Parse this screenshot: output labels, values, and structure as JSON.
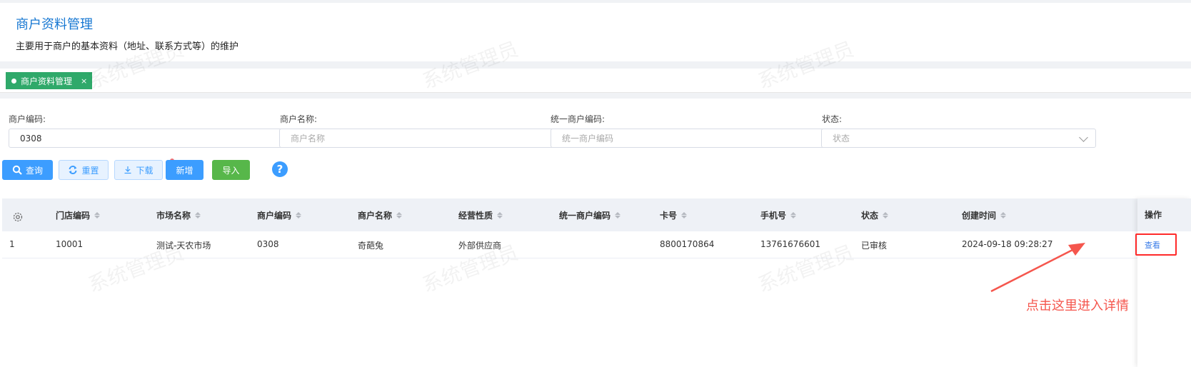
{
  "header": {
    "title": "商户资料管理",
    "description": "主要用于商户的基本资料（地址、联系方式等）的维护"
  },
  "tabs": [
    {
      "label": "商户资料管理",
      "close": "×"
    }
  ],
  "filters": {
    "merchant_code": {
      "label": "商户编码:",
      "value": "0308"
    },
    "merchant_name": {
      "label": "商户名称:",
      "placeholder": "商户名称"
    },
    "unified_code": {
      "label": "统一商户编码:",
      "placeholder": "统一商户编码"
    },
    "status": {
      "label": "状态:",
      "placeholder": "状态"
    }
  },
  "buttons": {
    "query": "查询",
    "reset": "重置",
    "download": "下载",
    "add": "新增",
    "import": "导入",
    "help": "?"
  },
  "table": {
    "columns": [
      "门店编码",
      "市场名称",
      "商户编码",
      "商户名称",
      "经营性质",
      "统一商户编码",
      "卡号",
      "手机号",
      "状态",
      "创建时间",
      "操作"
    ],
    "rows": [
      {
        "index": "1",
        "store_code": "10001",
        "market": "测试-天农市场",
        "merchant_code": "0308",
        "merchant_name": "奇葩兔",
        "business_type": "外部供应商",
        "unified_code": "",
        "card_no": "8800170864",
        "phone": "13761676601",
        "status": "已审核",
        "created": "2024-09-18 09:28:27",
        "action": "查看"
      }
    ]
  },
  "annotation": "点击这里进入详情",
  "watermark": "系统管理员",
  "colors": {
    "primary": "#3c9dff",
    "title_blue": "#1677d2",
    "tab_green": "#2fa96a",
    "import_green": "#57b74a",
    "annotation_red": "#f5564d"
  }
}
